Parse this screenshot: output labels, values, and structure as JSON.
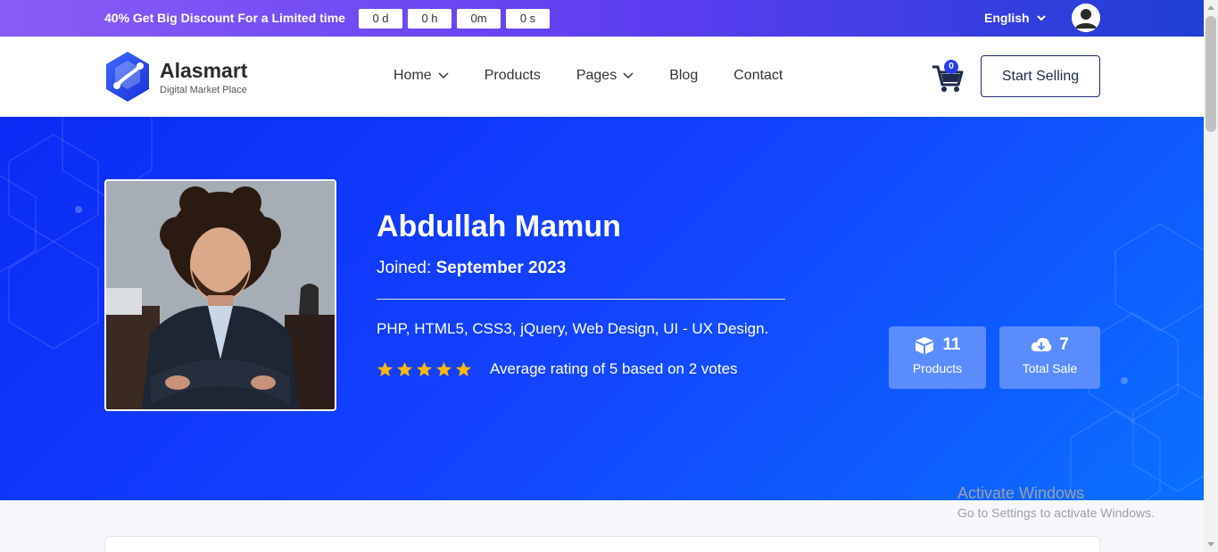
{
  "promo": {
    "text": "40% Get Big Discount For a Limited time",
    "countdown": [
      "0 d",
      "0 h",
      "0m",
      "0 s"
    ]
  },
  "language": {
    "selected": "English"
  },
  "brand": {
    "name": "Alasmart",
    "tagline": "Digital Market Place"
  },
  "nav": {
    "items": [
      {
        "label": "Home",
        "has_dropdown": true
      },
      {
        "label": "Products",
        "has_dropdown": false
      },
      {
        "label": "Pages",
        "has_dropdown": true
      },
      {
        "label": "Blog",
        "has_dropdown": false
      },
      {
        "label": "Contact",
        "has_dropdown": false
      }
    ]
  },
  "cart": {
    "count": "0"
  },
  "header": {
    "start_selling": "Start Selling"
  },
  "profile": {
    "name": "Abdullah Mamun",
    "joined_label": "Joined:",
    "joined_date": "September 2023",
    "skills": "PHP, HTML5, CSS3, jQuery, Web Design, UI - UX Design.",
    "rating_value": 5,
    "rating_text": "Average rating of 5 based on 2 votes"
  },
  "stats": {
    "products": {
      "value": "11",
      "label": "Products",
      "icon": "boxes-icon"
    },
    "sales": {
      "value": "7",
      "label": "Total Sale",
      "icon": "cloud-download-icon"
    }
  },
  "watermark": {
    "line1": "Activate Windows",
    "line2": "Go to Settings to activate Windows."
  },
  "colors": {
    "hero_start": "#0b2bf5",
    "hero_end": "#0a70ff",
    "stat_bg": "#5b8cff",
    "star": "#ffb800",
    "topbar_start": "#8b5cf6",
    "topbar_end": "#1f3fd4"
  }
}
